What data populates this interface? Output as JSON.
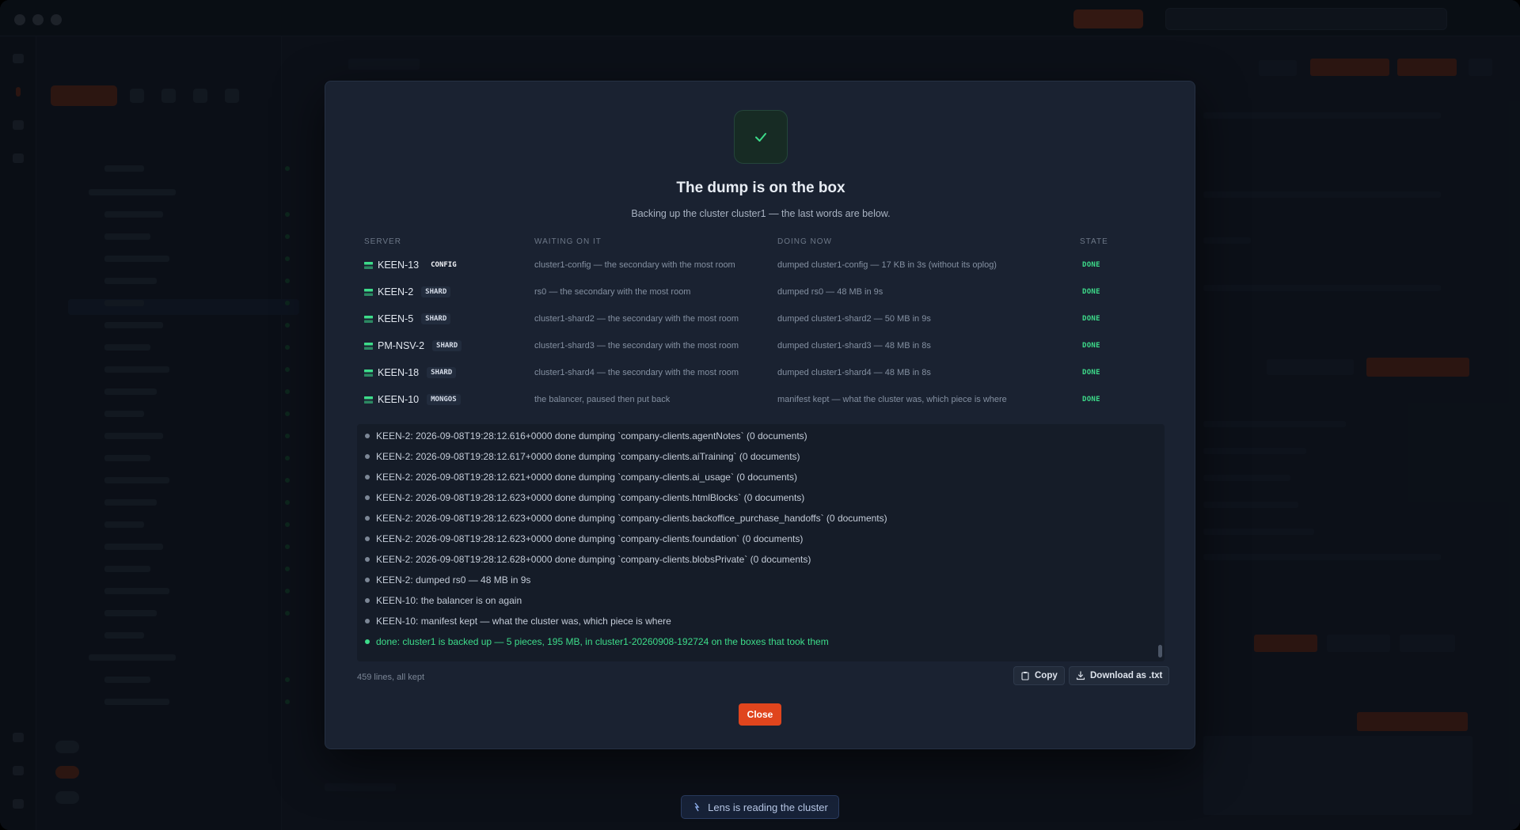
{
  "colors": {
    "accent": "#e0451d",
    "success": "#3ddc8a",
    "modal_bg": "#1a2231",
    "app_bg": "#141a24"
  },
  "status_bar": {
    "label": "Lens is reading the cluster",
    "icon": "pulse-icon"
  },
  "modal": {
    "icon": "check-icon",
    "title": "The dump is on the box",
    "subtitle": "Backing up the cluster cluster1 — the last words are below.",
    "columns": {
      "server": "SERVER",
      "waiting": "WAITING ON IT",
      "doing": "DOING NOW",
      "state": "STATE"
    },
    "rows": [
      {
        "server": "KEEN-13",
        "role": "CONFIG",
        "waiting": "cluster1-config — the secondary with the most room",
        "doing": "dumped cluster1-config — 17 KB in 3s (without its oplog)",
        "state": "DONE"
      },
      {
        "server": "KEEN-2",
        "role": "SHARD",
        "waiting": "rs0 — the secondary with the most room",
        "doing": "dumped rs0 — 48 MB in 9s",
        "state": "DONE"
      },
      {
        "server": "KEEN-5",
        "role": "SHARD",
        "waiting": "cluster1-shard2 — the secondary with the most room",
        "doing": "dumped cluster1-shard2 — 50 MB in 9s",
        "state": "DONE"
      },
      {
        "server": "PM-NSV-2",
        "role": "SHARD",
        "waiting": "cluster1-shard3 — the secondary with the most room",
        "doing": "dumped cluster1-shard3 — 48 MB in 8s",
        "state": "DONE"
      },
      {
        "server": "KEEN-18",
        "role": "SHARD",
        "waiting": "cluster1-shard4 — the secondary with the most room",
        "doing": "dumped cluster1-shard4 — 48 MB in 8s",
        "state": "DONE"
      },
      {
        "server": "KEEN-10",
        "role": "MONGOS",
        "waiting": "the balancer, paused then put back",
        "doing": "manifest kept — what the cluster was, which piece is where",
        "state": "DONE"
      }
    ],
    "log": [
      "KEEN-2: 2026-09-08T19:28:12.616+0000 done dumping `company-clients.agentNotes` (0 documents)",
      "KEEN-2: 2026-09-08T19:28:12.617+0000 done dumping `company-clients.aiTraining` (0 documents)",
      "KEEN-2: 2026-09-08T19:28:12.621+0000 done dumping `company-clients.ai_usage` (0 documents)",
      "KEEN-2: 2026-09-08T19:28:12.623+0000 done dumping `company-clients.htmlBlocks` (0 documents)",
      "KEEN-2: 2026-09-08T19:28:12.623+0000 done dumping `company-clients.backoffice_purchase_handoffs` (0 documents)",
      "KEEN-2: 2026-09-08T19:28:12.623+0000 done dumping `company-clients.foundation` (0 documents)",
      "KEEN-2: 2026-09-08T19:28:12.628+0000 done dumping `company-clients.blobsPrivate` (0 documents)",
      "KEEN-2: dumped rs0 — 48 MB in 9s",
      "KEEN-10: the balancer is on again",
      "KEEN-10: manifest kept — what the cluster was, which piece is where",
      "done: cluster1 is backed up — 5 pieces, 195 MB, in cluster1-20260908-192724 on the boxes that took them"
    ],
    "footer_note": "459 lines, all kept",
    "copy_label": "Copy",
    "download_label": "Download as .txt",
    "close_label": "Close"
  }
}
